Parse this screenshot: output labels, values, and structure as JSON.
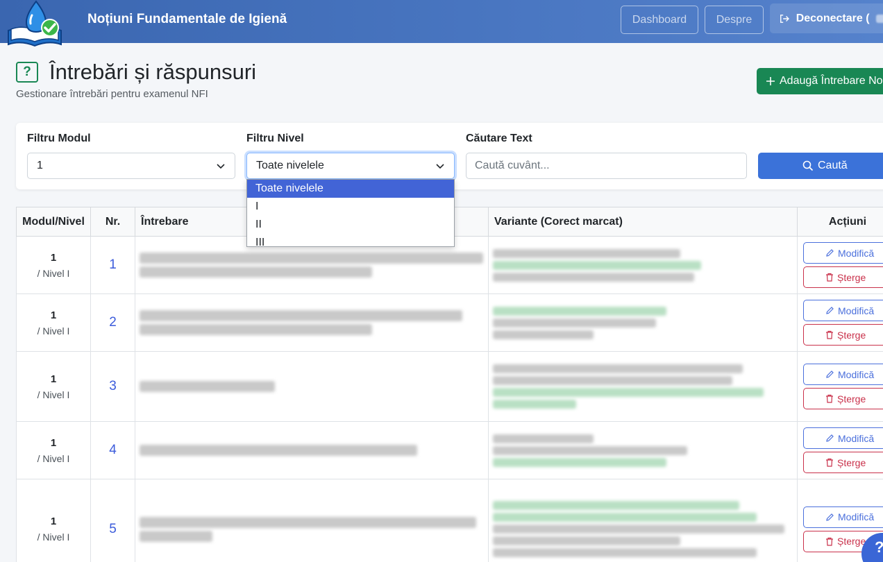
{
  "header": {
    "title": "Noțiuni Fundamentale de Igienă",
    "nav": {
      "dashboard": "Dashboard",
      "despre": "Despre",
      "logout": "Deconectare ("
    }
  },
  "page": {
    "title": "Întrebări și răspunsuri",
    "subtitle": "Gestionare întrebări pentru examenul NFI",
    "add_button": "Adaugă Întrebare No",
    "heading_icon": "?"
  },
  "filters": {
    "module_label": "Filtru Modul",
    "module_value": "1",
    "level_label": "Filtru Nivel",
    "level_value": "Toate nivelele",
    "level_options": [
      "Toate nivelele",
      "I",
      "II",
      "III"
    ],
    "search_label": "Căutare Text",
    "search_placeholder": "Caută cuvânt...",
    "search_button": "Caută"
  },
  "table": {
    "headers": {
      "module_level": "Modul/Nivel",
      "nr": "Nr.",
      "question": "Întrebare",
      "variants": "Variante (Corect marcat)",
      "actions": "Acțiuni"
    },
    "rows": [
      {
        "module": "1",
        "level": "/ Nivel I",
        "nr": "1"
      },
      {
        "module": "1",
        "level": "/ Nivel I",
        "nr": "2"
      },
      {
        "module": "1",
        "level": "/ Nivel I",
        "nr": "3"
      },
      {
        "module": "1",
        "level": "/ Nivel I",
        "nr": "4"
      },
      {
        "module": "1",
        "level": "/ Nivel I",
        "nr": "5"
      }
    ],
    "edit_label": "Modifică",
    "delete_label": "Șterge"
  },
  "help_fab": "?",
  "colors": {
    "header": "#4a77c2",
    "primary": "#3b72d9",
    "success": "#198754",
    "danger": "#c9304a"
  }
}
